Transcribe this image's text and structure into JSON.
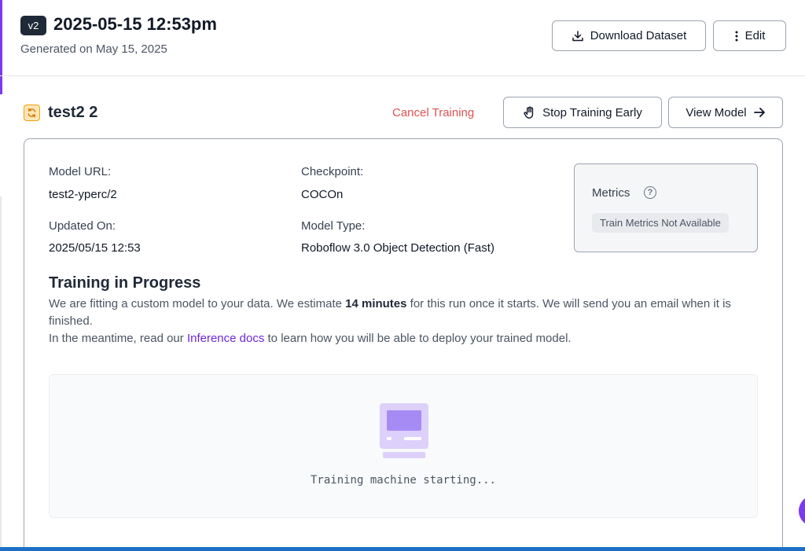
{
  "header": {
    "version_badge": "v2",
    "title": "2025-05-15 12:53pm",
    "subtitle": "Generated on May 15, 2025",
    "download_label": "Download Dataset",
    "edit_label": "Edit"
  },
  "model": {
    "name": "test2 2",
    "cancel_label": "Cancel Training",
    "stop_label": "Stop Training Early",
    "view_label": "View Model"
  },
  "info": {
    "model_url_label": "Model URL:",
    "model_url_value": "test2-yperc/2",
    "checkpoint_label": "Checkpoint:",
    "checkpoint_value": "COCOn",
    "updated_label": "Updated On:",
    "updated_value": "2025/05/15 12:53",
    "model_type_label": "Model Type:",
    "model_type_value": "Roboflow 3.0 Object Detection (Fast)"
  },
  "metrics": {
    "title": "Metrics",
    "help_glyph": "?",
    "status": "Train Metrics Not Available"
  },
  "progress": {
    "title": "Training in Progress",
    "line1_prefix": "We are fitting a custom model to your data. We estimate ",
    "line1_strong": "14 minutes",
    "line1_suffix": " for this run once it starts. We will send you an email when it is finished.",
    "line2_prefix": "In the meantime, read our ",
    "line2_link": "Inference docs",
    "line2_suffix": " to learn how you will be able to deploy your trained model."
  },
  "machine": {
    "status": "Training machine starting..."
  },
  "colors": {
    "accent": "#6d28d9",
    "danger": "#e05252",
    "badge_bg": "#1f2937"
  },
  "icons": {
    "download": "download-icon",
    "more": "vertical-dots-icon",
    "model": "refresh-icon",
    "stop": "hand-icon",
    "view": "arrow-right-icon",
    "help": "question-circle-icon",
    "machine": "computer-icon"
  }
}
